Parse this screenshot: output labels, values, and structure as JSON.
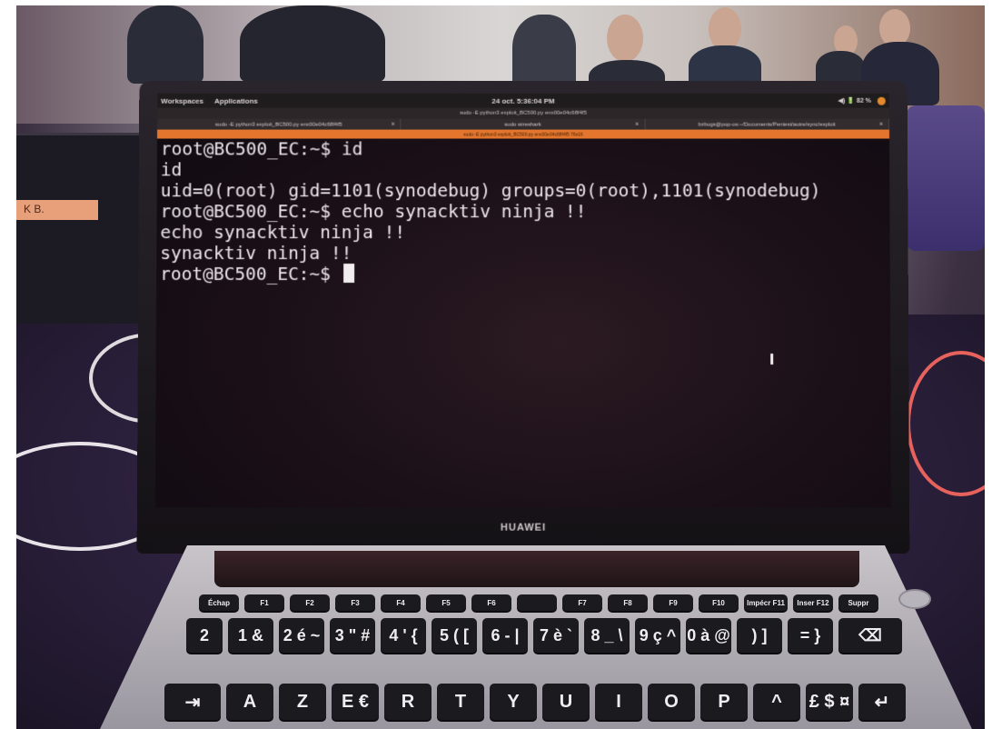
{
  "desktop": {
    "workspaces_label": "Workspaces",
    "applications_label": "Applications",
    "clock": "24 oct.  5:36:04 PM",
    "status": "◀)  🔋 82 %"
  },
  "window_title": "sudo -E python3 exploit_BC500.py enx00e04c68f4f5",
  "tabs": [
    {
      "label": "sudo -E python3 exploit_BC500.py enx00e04c68f4f5",
      "close": "×"
    },
    {
      "label": "sudo wireshark",
      "close": "×"
    },
    {
      "label": "bzbugs@pop-os:~/Documents/Pentest/autre/sync/exploit",
      "close": "×"
    }
  ],
  "subtitle": "sudo -E python3 exploit_BC500.py enx00e04c68f4f5 76x16",
  "terminal_lines": [
    "root@BC500_EC:~$ id",
    "id",
    "uid=0(root) gid=1101(synodebug) groups=0(root),1101(synodebug)",
    "root@BC500_EC:~$ echo synacktiv ninja !!",
    "echo synacktiv ninja !!",
    "synacktiv ninja !!",
    "root@BC500_EC:~$ "
  ],
  "brand": "HUAWEI",
  "side_label": "K  B.",
  "keyboard": {
    "fn_row": [
      "Échap",
      "F1",
      "F2",
      "F3",
      "F4",
      "F5",
      "F6",
      "",
      "F7",
      "F8",
      "F9",
      "F10",
      "Impécr F11",
      "Inser F12",
      "Suppr"
    ],
    "num_row": [
      "2",
      "1 &",
      "2 é ~",
      "3 \" #",
      "4 ' {",
      "5 ( [",
      "6 - |",
      "7 è `",
      "8 _ \\",
      "9 ç ^",
      "0 à @",
      ") ]",
      "= }",
      "⌫"
    ],
    "alpha_row": [
      "⇥",
      "A",
      "Z",
      "E €",
      "R",
      "T",
      "Y",
      "U",
      "I",
      "O",
      "P",
      "^",
      "£ $ ¤",
      "↵"
    ]
  }
}
